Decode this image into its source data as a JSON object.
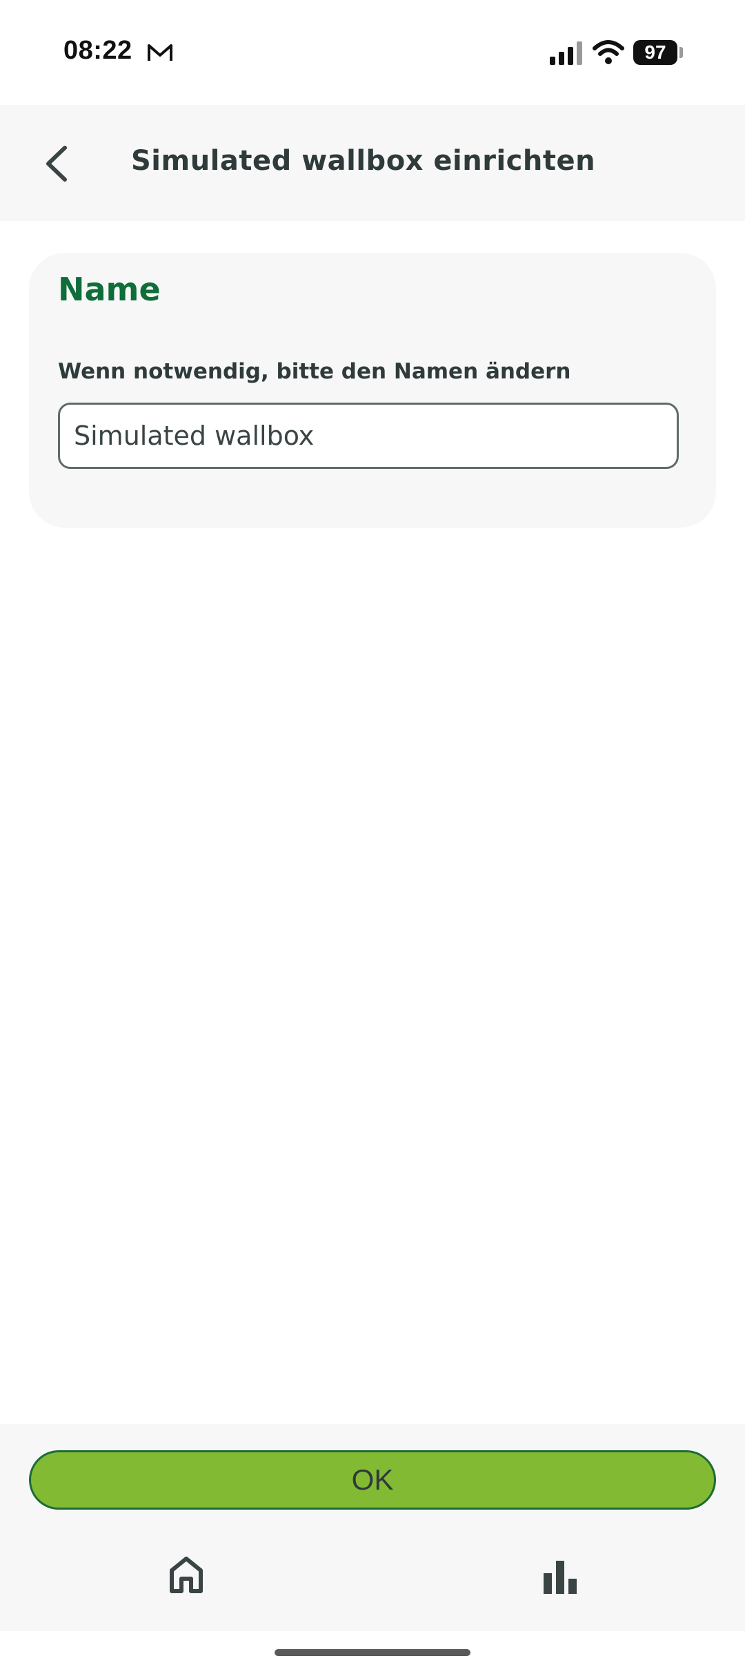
{
  "status_bar": {
    "time": "08:22",
    "battery": "97",
    "icons": [
      "gmail-icon",
      "signal-icon",
      "wifi-icon",
      "battery-icon"
    ]
  },
  "header": {
    "title": "Simulated wallbox einrichten",
    "back_icon": "chevron-left-icon"
  },
  "card": {
    "title": "Name",
    "field_label": "Wenn notwendig, bitte den Namen ändern",
    "name_value": "Simulated wallbox"
  },
  "actions": {
    "ok_label": "OK"
  },
  "bottom_nav": {
    "items": [
      "home-icon",
      "bar-chart-icon"
    ]
  },
  "colors": {
    "accent_green": "#82bb33",
    "title_green": "#0e6d38",
    "panel_gray": "#f7f7f7"
  }
}
